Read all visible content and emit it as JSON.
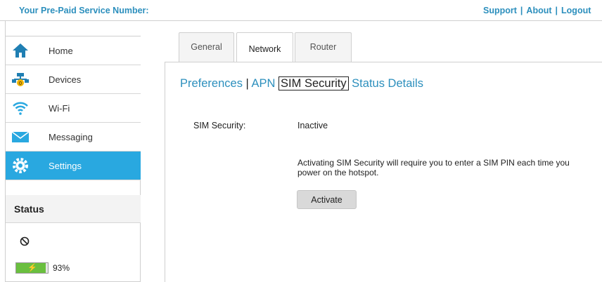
{
  "header": {
    "service_label": "Your Pre-Paid Service Number:",
    "links": [
      "Support",
      "About",
      "Logout"
    ]
  },
  "sidebar": {
    "items": [
      {
        "label": "Home",
        "icon": "home-icon"
      },
      {
        "label": "Devices",
        "icon": "devices-icon"
      },
      {
        "label": "Wi-Fi",
        "icon": "wifi-icon"
      },
      {
        "label": "Messaging",
        "icon": "envelope-icon"
      },
      {
        "label": "Settings",
        "icon": "gear-icon",
        "active": true
      }
    ],
    "status_title": "Status",
    "battery_percent_text": "93%",
    "battery_level": 0.93
  },
  "tabs": [
    {
      "label": "General"
    },
    {
      "label": "Network",
      "active": true
    },
    {
      "label": "Router"
    }
  ],
  "subnav": {
    "preferences": "Preferences",
    "apn": "APN",
    "sim_security": "SIM Security",
    "status_details": "Status Details"
  },
  "sim": {
    "label": "SIM Security:",
    "value": "Inactive",
    "description": "Activating SIM Security will require you to enter a SIM PIN each time you power on the hotspot.",
    "activate_label": "Activate"
  },
  "colors": {
    "accent": "#29a8e0",
    "link": "#2c8fbd",
    "battery": "#6abf3f"
  }
}
